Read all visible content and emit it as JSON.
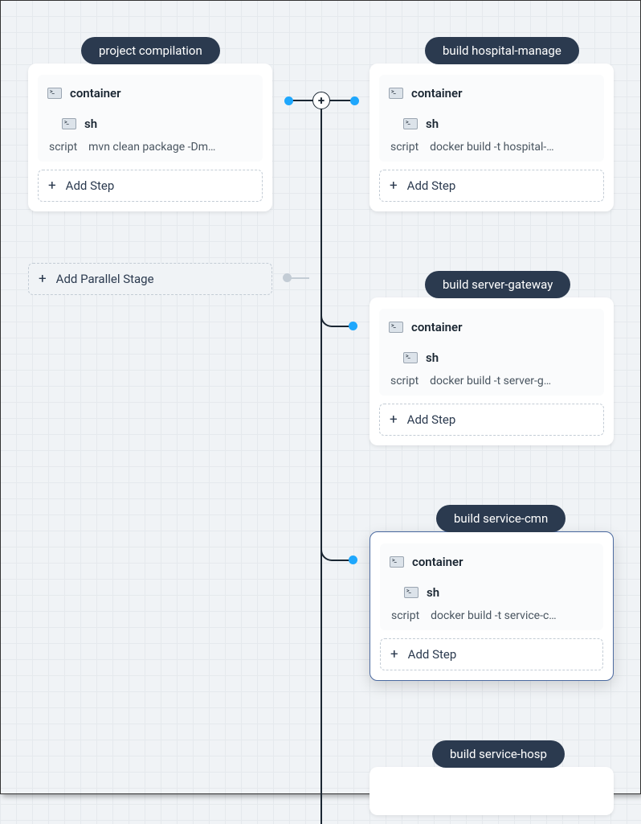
{
  "stages": {
    "left": {
      "pill": "project compilation",
      "container": "container",
      "sh": "sh",
      "script_label": "script",
      "script": "mvn clean package -Dm…",
      "add_step": "Add Step"
    },
    "right1": {
      "pill": "build hospital-manage",
      "container": "container",
      "sh": "sh",
      "script_label": "script",
      "script": "docker build -t hospital-…",
      "add_step": "Add Step"
    },
    "right2": {
      "pill": "build server-gateway",
      "container": "container",
      "sh": "sh",
      "script_label": "script",
      "script": "docker build -t server-g…",
      "add_step": "Add Step"
    },
    "right3": {
      "pill": "build service-cmn",
      "container": "container",
      "sh": "sh",
      "script_label": "script",
      "script": "docker build -t service-c…",
      "add_step": "Add Step"
    },
    "right4": {
      "pill": "build service-hosp"
    }
  },
  "add_parallel": "Add Parallel Stage",
  "colors": {
    "pill_bg": "#2b3a4f",
    "accent_dot": "#1ea7fd",
    "grey_dot": "#c3ccd5"
  }
}
